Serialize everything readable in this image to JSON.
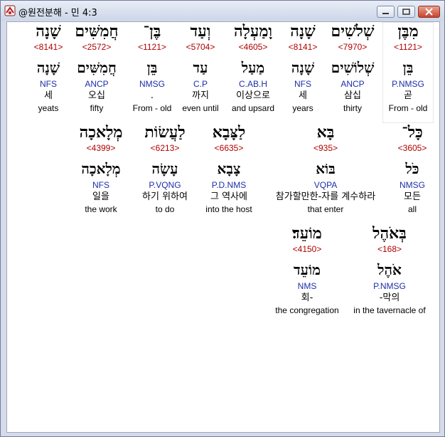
{
  "window": {
    "title": "@원전분해 - 민 4:3"
  },
  "words": [
    {
      "hebrew": "מִבֶּן",
      "strong": "<1121>",
      "lemma": "בֵּן",
      "parse": "P.NMSG",
      "korean": "곧",
      "english": "From - old"
    },
    {
      "hebrew": "שְׁלֹשִׁים",
      "strong": "<7970>",
      "lemma": "שְׁלוֹשִׁים",
      "parse": "ANCP",
      "korean": "삼십",
      "english": "thirty"
    },
    {
      "hebrew": "שָׁנָה",
      "strong": "<8141>",
      "lemma": "שָׁנָה",
      "parse": "NFS",
      "korean": "세",
      "english": "years"
    },
    {
      "hebrew": "וָמַעְלָה",
      "strong": "<4605>",
      "lemma": "מַעַל",
      "parse": "C.AB.H",
      "korean": "이상으로",
      "english": "and upsard"
    },
    {
      "hebrew": "וְעַד",
      "strong": "<5704>",
      "lemma": "עַד",
      "parse": "C.P",
      "korean": "까지",
      "english": "even until"
    },
    {
      "hebrew": "בֶּן־",
      "strong": "<1121>",
      "lemma": "בֵּן",
      "parse": "NMSG",
      "korean": ".",
      "english": "From - old"
    },
    {
      "hebrew": "חֲמִשִּׁים",
      "strong": "<2572>",
      "lemma": "חֲמִשִּׁים",
      "parse": "ANCP",
      "korean": "오십",
      "english": "fifty"
    },
    {
      "hebrew": "שָׁנָה",
      "strong": "<8141>",
      "lemma": "שָׁנָה",
      "parse": "NFS",
      "korean": "세",
      "english": "yeats"
    },
    {
      "hebrew": "כָּל־",
      "strong": "<3605>",
      "lemma": "כֹּל",
      "parse": "NMSG",
      "korean": "모든",
      "english": "all"
    },
    {
      "hebrew": "בָּא",
      "strong": "<935>",
      "lemma": "בּוֹא",
      "parse": "VQPA",
      "korean": "참가할만한-자를 계수하라",
      "english": "that enter"
    },
    {
      "hebrew": "לַצָּבָא",
      "strong": "<6635>",
      "lemma": "צָבָא",
      "parse": "P.D.NMS",
      "korean": "그 역사에",
      "english": "into the host"
    },
    {
      "hebrew": "לַעֲשׂוֹת",
      "strong": "<6213>",
      "lemma": "עָשָׂה",
      "parse": "P.VQNG",
      "korean": "하기 위하여",
      "english": "to do"
    },
    {
      "hebrew": "מְלָאכָה",
      "strong": "<4399>",
      "lemma": "מְלָאכָה",
      "parse": "NFS",
      "korean": "일을",
      "english": "the work"
    },
    {
      "hebrew": "בְּאֹהֶל",
      "strong": "<168>",
      "lemma": "אֹהֶל",
      "parse": "P.NMSG",
      "korean": "-막의",
      "english": "in the tavernacle of"
    },
    {
      "hebrew": "מוֹעֵד׃",
      "strong": "<4150>",
      "lemma": "מוֹעֵד",
      "parse": "NMS",
      "korean": "회-",
      "english": "the congregation"
    }
  ]
}
